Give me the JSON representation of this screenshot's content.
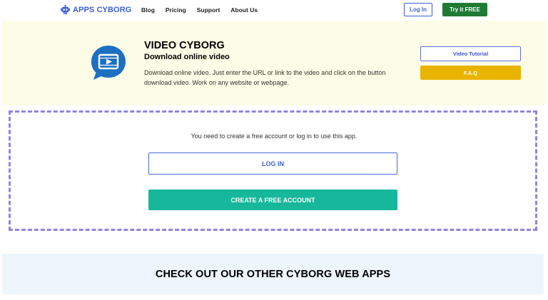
{
  "nav": {
    "brand": "APPS CYBORG",
    "links": [
      "Blog",
      "Pricing",
      "Support",
      "About Us"
    ],
    "login_label": "Log In",
    "try_label": "Try it FREE"
  },
  "hero": {
    "title": "VIDEO CYBORG",
    "subtitle": "Download online video",
    "description": "Download online video. Just enter the URL or link to the video and click on the button download video. Work on any website or webpage.",
    "tutorial_label": "Video Tutorial",
    "faq_label": "F.A.Q"
  },
  "login_box": {
    "message": "You need to create a free account or log in to use this app.",
    "login_label": "LOG IN",
    "create_label": "CREATE A FREE ACCOUNT"
  },
  "other_apps": {
    "title": "CHECK OUT OUR OTHER CYBORG WEB APPS"
  },
  "colors": {
    "brand_blue": "#3b5fd9",
    "try_green": "#1f7a34",
    "hero_bg": "#fdfce6",
    "faq_yellow": "#e8b400",
    "create_teal": "#16b79b",
    "dashed_border": "#8a86e8",
    "app_icon_blue": "#1d6fc2"
  },
  "icons": {
    "logo": "robot-logo-icon",
    "app": "video-chat-bubble-icon"
  }
}
